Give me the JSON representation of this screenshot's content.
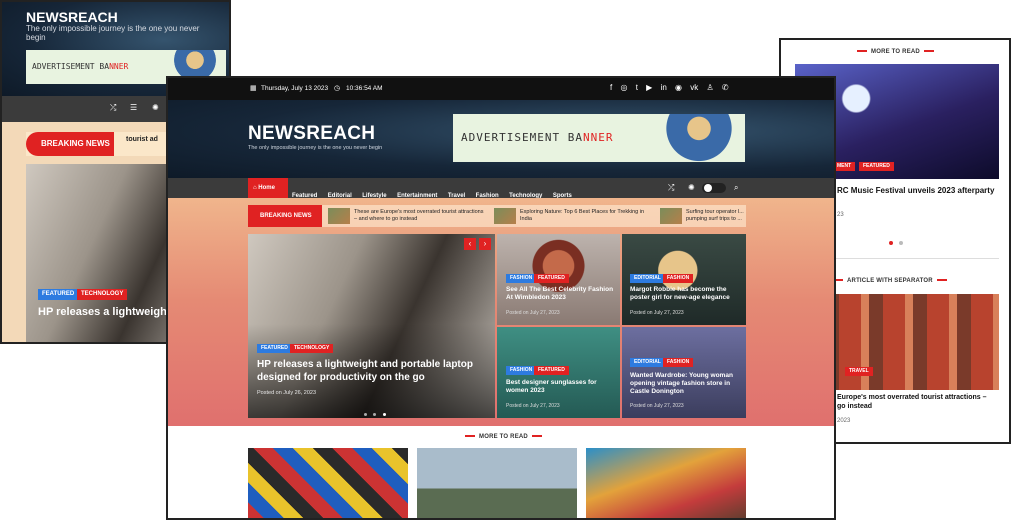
{
  "brand": {
    "name": "NEWSREACH",
    "tagline": "The only impossible journey is the one you never begin",
    "ad_banner": "ADVERTISEMENT BA",
    "ad_banner_hl": "NNER"
  },
  "topbar": {
    "date": "Thursday, July 13 2023",
    "time": "10:36:54 AM",
    "social_icons": [
      "facebook-icon",
      "instagram-icon",
      "twitter-icon",
      "youtube-icon",
      "linkedin-icon",
      "spotify-icon",
      "vk-icon",
      "snapchat-icon",
      "whatsapp-icon"
    ]
  },
  "nav": {
    "items": [
      "Home",
      "Featured",
      "Editorial",
      "Lifestyle",
      "Entertainment",
      "Travel",
      "Fashion",
      "Technology",
      "Sports"
    ]
  },
  "ticker": {
    "label": "BREAKING NEWS",
    "items": [
      "These are Europe's most overrated tourist attractions – and where to go instead",
      "Exploring Nature: Top 6 Best Places for Trekking in India",
      "Surfing tour operator l... pumping surf trips to ..."
    ]
  },
  "hero": {
    "tags": [
      "FEATURED",
      "TECHNOLOGY"
    ],
    "title": "HP releases a lightweight and portable laptop designed for productivity on the go",
    "date": "Posted on July 26, 2023"
  },
  "grid": [
    {
      "tags": [
        "FASHION",
        "FEATURED"
      ],
      "title": "See All The Best Celebrity Fashion At Wimbledon 2023",
      "date": "Posted on July 27, 2023"
    },
    {
      "tags": [
        "EDITORIAL",
        "FASHION"
      ],
      "title": "Margot Robbie has become the poster girl for new-age elegance",
      "date": "Posted on July 27, 2023"
    },
    {
      "tags": [
        "FASHION",
        "FEATURED"
      ],
      "title": "Best designer sunglasses for women 2023",
      "date": "Posted on July 27, 2023"
    },
    {
      "tags": [
        "EDITORIAL",
        "FASHION"
      ],
      "title": "Wanted Wardrobe: Young woman opening vintage fashion store in Castle Donington",
      "date": "Posted on July 27, 2023"
    }
  ],
  "more_to_read": {
    "title": "MORE TO READ"
  },
  "left_panel": {
    "brand": "NEWSREACH",
    "tagline": "The only impossible journey is the one you never begin",
    "breaking_label": "BREAKING NEWS",
    "breaking_text": "tourist ad",
    "tags": [
      "FEATURED",
      "TECHNOLOGY"
    ],
    "headline": "HP releases a lightweight and portable laptop designed for productivity on the go"
  },
  "right_panel": {
    "section1": "MORE TO READ",
    "tags1": [
      "MENT",
      "FEATURED"
    ],
    "title1": "RC Music Festival unveils 2023 afterparty",
    "date1": "23",
    "section2": "ARTICLE WITH SEPARATOR",
    "tag2": "TRAVEL",
    "title2": "Europe's most overrated tourist attractions – go instead",
    "date2": "2023"
  },
  "colors": {
    "accent": "#e02222",
    "nav_bg": "#3b3b3b",
    "tag_blue": "#2d7be0"
  }
}
